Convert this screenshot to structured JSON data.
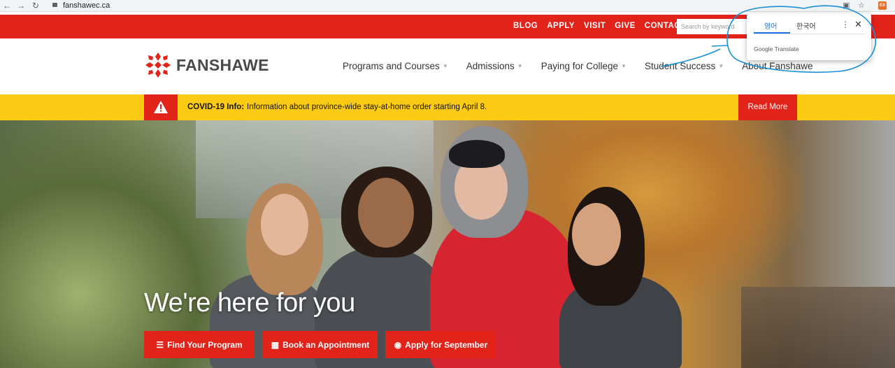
{
  "browser": {
    "url": "fanshawec.ca"
  },
  "topbar": {
    "links": [
      "BLOG",
      "APPLY",
      "VISIT",
      "GIVE",
      "CONTACT"
    ],
    "search_placeholder": "Search by keyword"
  },
  "header": {
    "logo_text": "FANSHAWE",
    "nav": [
      {
        "label": "Programs and Courses",
        "caret": true
      },
      {
        "label": "Admissions",
        "caret": true
      },
      {
        "label": "Paying for College",
        "caret": true
      },
      {
        "label": "Student Success",
        "caret": true
      },
      {
        "label": "About Fanshawe",
        "caret": false
      }
    ]
  },
  "alert": {
    "label": "COVID-19 Info:",
    "message": "Information about province-wide stay-at-home order starting April 8.",
    "button": "Read More"
  },
  "hero": {
    "title": "We're here for you",
    "buttons": [
      {
        "label": "Find Your Program",
        "icon": "list-icon"
      },
      {
        "label": "Book an Appointment",
        "icon": "calendar-icon"
      },
      {
        "label": "Apply for September",
        "icon": "user-icon"
      }
    ]
  },
  "translate_popup": {
    "tabs": [
      "영어",
      "한국어"
    ],
    "active_tab": 0,
    "brand": "Google Translate"
  },
  "colors": {
    "brand_red": "#e2231a",
    "alert_yellow": "#fdcb14",
    "translate_blue": "#1a73e8"
  }
}
